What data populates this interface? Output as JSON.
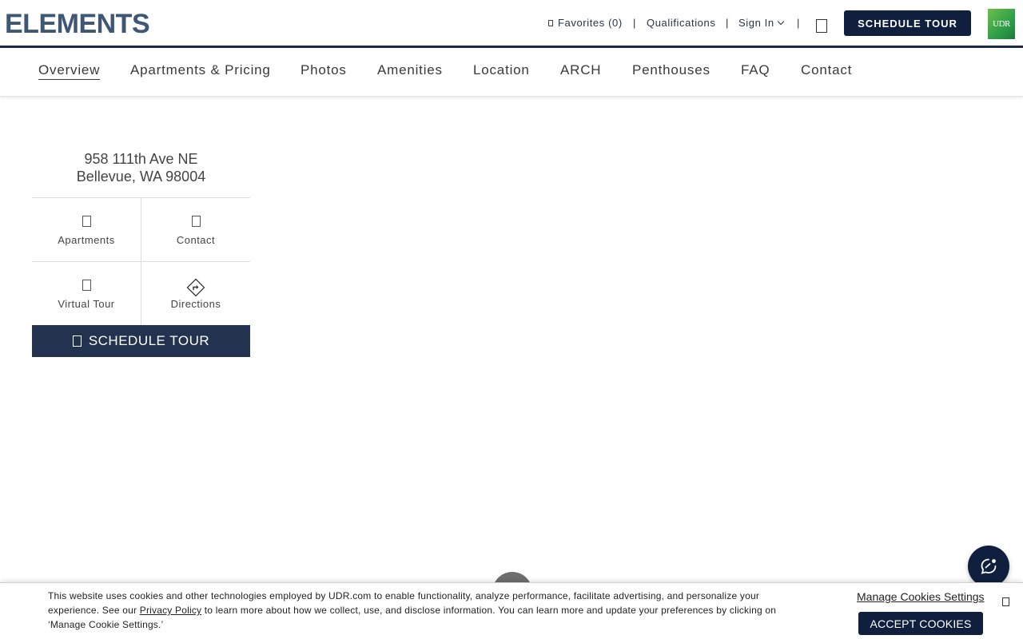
{
  "header": {
    "logo": "ELEMENTS",
    "favorites_label": "Favorites (0)",
    "qualifications_label": "Qualifications",
    "sign_in_label": "Sign In",
    "separator": "|",
    "schedule_tour_label": "SCHEDULE TOUR",
    "udr_logo": "UDR"
  },
  "nav": {
    "items": [
      {
        "label": "Overview",
        "active": true
      },
      {
        "label": "Apartments & Pricing"
      },
      {
        "label": "Photos"
      },
      {
        "label": "Amenities"
      },
      {
        "label": "Location"
      },
      {
        "label": "ARCH"
      },
      {
        "label": "Penthouses"
      },
      {
        "label": "FAQ"
      },
      {
        "label": "Contact"
      }
    ]
  },
  "sidebar": {
    "address_line1": "958 111th Ave NE",
    "address_line2": "Bellevue, WA 98004",
    "tiles": [
      {
        "label": "Apartments",
        "icon": "apartments-icon"
      },
      {
        "label": "Contact",
        "icon": "contact-icon"
      },
      {
        "label": "Virtual Tour",
        "icon": "virtual-tour-icon"
      },
      {
        "label": "Directions",
        "icon": "directions-icon"
      }
    ],
    "schedule_tour_label": "SCHEDULE TOUR"
  },
  "cookie": {
    "text_part1": "This website uses cookies and other technologies employed by UDR.com to enable functionality, analyze performance, facilitate advertising, and personalize your experience. See our ",
    "privacy_link": "Privacy Policy",
    "text_part2": " to learn more about how we collect, use, and disclose information. You can learn more and update your preferences by clicking on ‘Manage Cookie Settings.’",
    "manage_label": "Manage Cookies Settings",
    "accept_label": "ACCEPT COOKIES"
  },
  "colors": {
    "navy": "#0f1f3d",
    "logo_blue": "#3d5775",
    "side_button": "#23324f",
    "udr_green": "#2e9e49"
  }
}
